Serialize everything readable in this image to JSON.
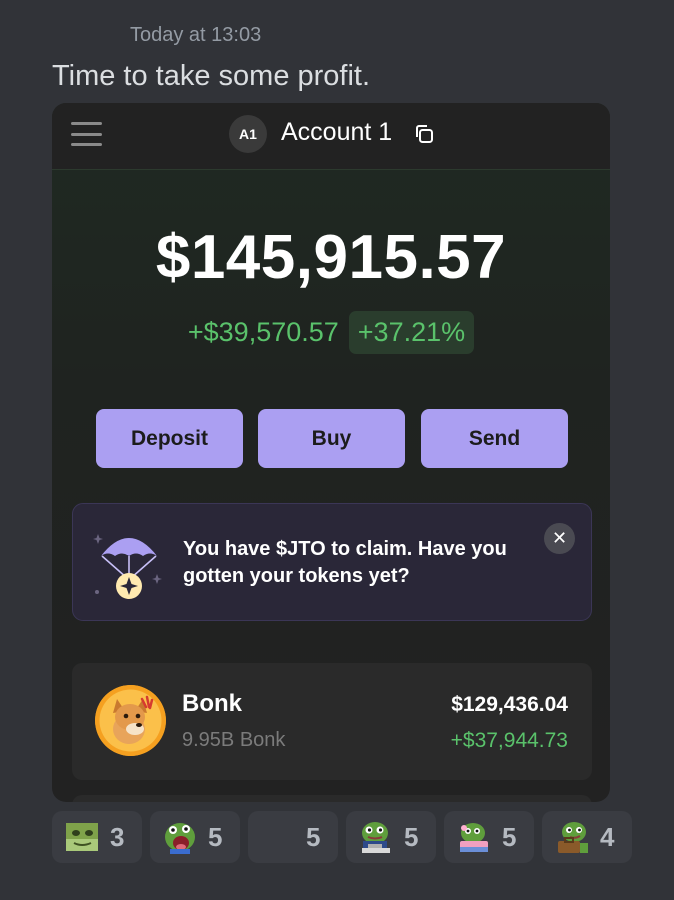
{
  "message": {
    "timestamp": "Today at 13:03",
    "text": "Time to take some profit."
  },
  "wallet": {
    "avatar_initials": "A1",
    "account_name": "Account 1",
    "balance": "$145,915.57",
    "pnl_abs": "+$39,570.57",
    "pnl_pct": "+37.21%",
    "buttons": {
      "deposit": "Deposit",
      "buy": "Buy",
      "send": "Send"
    },
    "promo": {
      "text": "You have $JTO to claim. Have you gotten your tokens yet?"
    },
    "tokens": [
      {
        "name": "Bonk",
        "amount": "9.95B Bonk",
        "value": "$129,436.04",
        "change": "+$37,944.73"
      }
    ],
    "colors": {
      "accent": "#ab9ff2",
      "positive": "#5ac26b"
    }
  },
  "reactions": [
    {
      "emoji": "pepe-face",
      "count": "3"
    },
    {
      "emoji": "pepe-shout",
      "count": "5"
    },
    {
      "emoji": "blank",
      "count": "5"
    },
    {
      "emoji": "pepe-laptop",
      "count": "5"
    },
    {
      "emoji": "pepe-cake",
      "count": "5"
    },
    {
      "emoji": "pepe-briefcase",
      "count": "4"
    }
  ]
}
